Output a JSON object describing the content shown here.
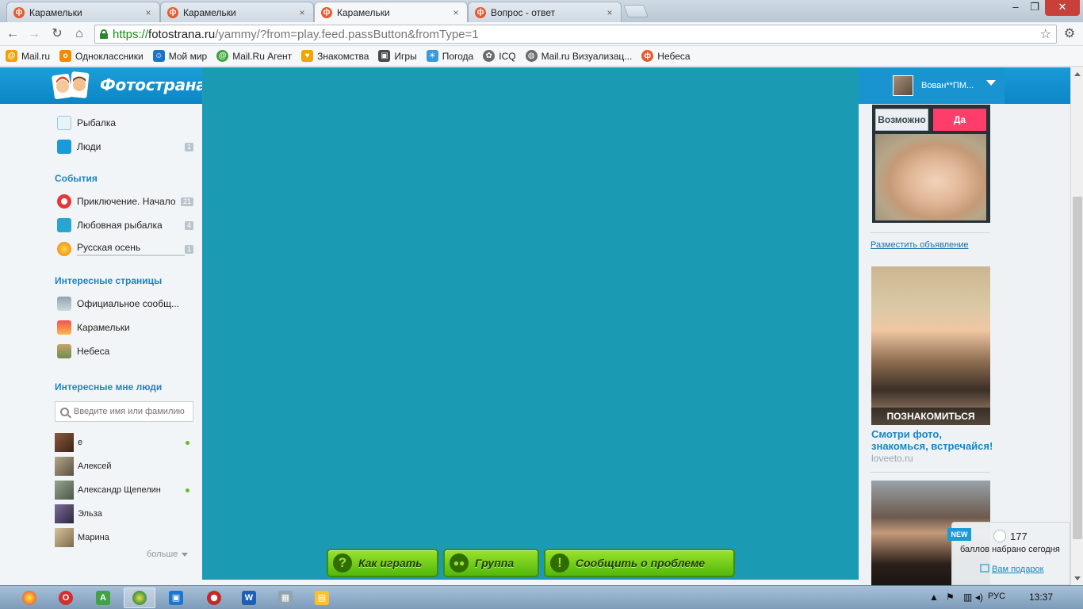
{
  "browser": {
    "tabs": [
      {
        "label": "Карамельки",
        "active": false
      },
      {
        "label": "Карамельки",
        "active": false
      },
      {
        "label": "Карамельки",
        "active": true
      },
      {
        "label": "Вопрос - ответ",
        "active": false
      }
    ],
    "url": {
      "scheme": "https://",
      "host": "fotostrana.ru",
      "path": "/yammy/?from=play.feed.passButton&fromType=1"
    },
    "bookmarks": [
      {
        "label": "Mail.ru",
        "icon": "mailru-icon",
        "color": "#f2a100"
      },
      {
        "label": "Одноклассники",
        "icon": "odnoklassniki-icon",
        "color": "#f28a00"
      },
      {
        "label": "Мой мир",
        "icon": "moimir-icon",
        "color": "#1b74c6"
      },
      {
        "label": "Mail.Ru Агент",
        "icon": "agent-icon",
        "color": "#3aa63a"
      },
      {
        "label": "Знакомства",
        "icon": "dating-icon",
        "color": "#f0a500"
      },
      {
        "label": "Игры",
        "icon": "games-icon",
        "color": "#4a4a4a"
      },
      {
        "label": "Погода",
        "icon": "weather-icon",
        "color": "#3a9ad9"
      },
      {
        "label": "ICQ",
        "icon": "icq-icon",
        "color": "#6b6b6b"
      },
      {
        "label": "Mail.ru Визуализац...",
        "icon": "globe-icon",
        "color": "#6b6b6b"
      },
      {
        "label": "Небеса",
        "icon": "fotostrana-icon",
        "color": "#e65a2e"
      }
    ]
  },
  "header": {
    "logo_text": "Фотострана",
    "user_name": "Вован**ПМ..."
  },
  "sidebar": {
    "apps": [
      {
        "label": "Рыбалка",
        "count": ""
      },
      {
        "label": "Люди",
        "count": "1"
      }
    ],
    "events_heading": "События",
    "events": [
      {
        "label": "Приключение. Начало",
        "count": "21"
      },
      {
        "label": "Любовная рыбалка",
        "count": "4"
      },
      {
        "label": "Русская осень",
        "count": "1"
      }
    ],
    "pages_heading": "Интересные страницы",
    "pages": [
      {
        "label": "Официальное сообщ..."
      },
      {
        "label": "Карамельки"
      },
      {
        "label": "Небеса"
      }
    ],
    "people_heading": "Интересные мне люди",
    "search_placeholder": "Введите имя или фамилию",
    "people": [
      {
        "name": "е",
        "online": true
      },
      {
        "name": "Алексей",
        "online": false
      },
      {
        "name": "Александр Щепелин",
        "online": true
      },
      {
        "name": "Эльза",
        "online": false
      },
      {
        "name": "Марина",
        "online": false
      }
    ],
    "more_label": "больше"
  },
  "game": {
    "buttons": [
      {
        "label": "Как играть",
        "icon": "question-icon",
        "glyph": "?"
      },
      {
        "label": "Группа",
        "icon": "group-icon",
        "glyph": "●"
      },
      {
        "label": "Сообщить о проблеме",
        "icon": "warning-icon",
        "glyph": "!"
      }
    ]
  },
  "right": {
    "maybe_label": "Возможно",
    "yes_label": "Да",
    "post_ad_label": "Разместить объявление",
    "ad1_cta": "ПОЗНАКОМИТЬСЯ",
    "ad1_text": "Смотри фото, знакомься, встречайся!",
    "ad1_domain": "loveeto.ru",
    "points": {
      "badge": "NEW",
      "count": "177",
      "label": "баллов набрано сегодня",
      "gift_link": "Вам подарок"
    }
  },
  "taskbar": {
    "lang": "РУС",
    "time": "13:37"
  },
  "colors": {
    "brand_blue": "#1a9ad8",
    "game_bg": "#1a9bb3",
    "green_button": "#6fcf1a",
    "yes_pink": "#ff3d6a"
  }
}
